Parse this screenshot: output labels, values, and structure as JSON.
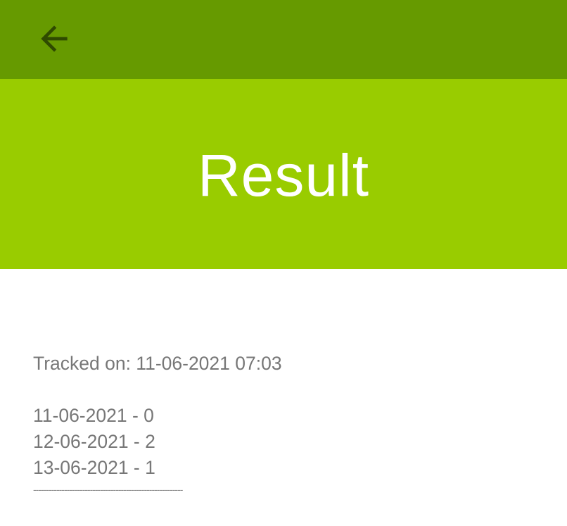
{
  "toolbar": {
    "background": "#669a00",
    "back_icon": "arrow-left-icon",
    "icon_color": "#2f4a00"
  },
  "header": {
    "title": "Result",
    "background": "#99cc00"
  },
  "result": {
    "tracked_on": "Tracked on: 11-06-2021 07:03",
    "entries": [
      "11-06-2021 - 0",
      "12-06-2021 - 2",
      "13-06-2021 - 1"
    ],
    "separator": "----------------------------------------------------------"
  }
}
